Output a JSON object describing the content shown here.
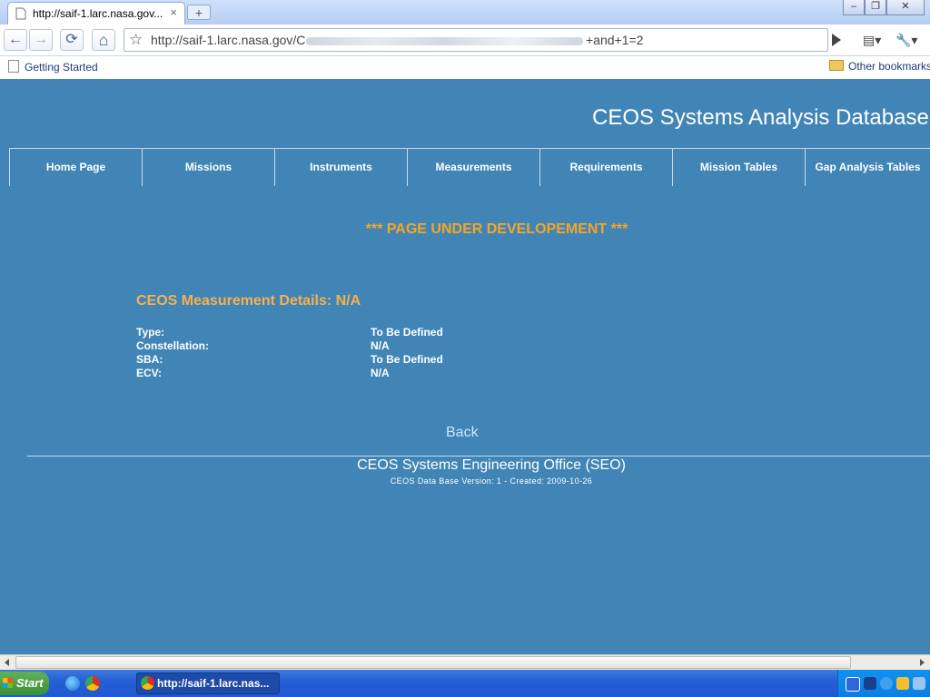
{
  "browser": {
    "tab_title": "http://saif-1.larc.nasa.gov...",
    "tab_close": "×",
    "new_tab": "+",
    "window_buttons": {
      "minimize": "–",
      "restore": "❐",
      "close": "✕"
    },
    "url_start": "http://saif-1.larc.nasa.gov/C",
    "url_end": "+and+1=2",
    "icons": [
      "back-icon",
      "forward-icon",
      "reload-icon",
      "home-icon",
      "star-icon",
      "go-icon",
      "page-menu-icon",
      "wrench-icon"
    ],
    "glyphs": {
      "back": "←",
      "forward": "→",
      "reload": "⟳",
      "home": "⌂",
      "star": "☆",
      "page_menu": "▤▾",
      "wrench": "🔧▾"
    }
  },
  "bookmarks": {
    "left": "Getting Started",
    "right": "Other bookmarks"
  },
  "page": {
    "site_title": "CEOS Systems Analysis Database",
    "nav": [
      "Home Page",
      "Missions",
      "Instruments",
      "Measurements",
      "Requirements",
      "Mission Tables",
      "Gap Analysis Tables"
    ],
    "notice": "*** PAGE UNDER DEVELOPEMENT ***",
    "details_heading": "CEOS Measurement Details: N/A",
    "details": [
      {
        "label": "Type:",
        "value": "To Be Defined"
      },
      {
        "label": "Constellation:",
        "value": "N/A"
      },
      {
        "label": "SBA:",
        "value": "To Be Defined"
      },
      {
        "label": "ECV:",
        "value": "N/A"
      }
    ],
    "back_link": "Back",
    "footer_title": "CEOS Systems Engineering Office (SEO)",
    "footer_version": "CEOS Data Base Version: 1 - Created: 2009-10-26"
  },
  "taskbar": {
    "start_label": "Start",
    "task_item": "http://saif-1.larc.nas..."
  },
  "colors": {
    "page_background": "#4185b6",
    "notice": "#f6a525",
    "heading": "#f6b14d"
  }
}
